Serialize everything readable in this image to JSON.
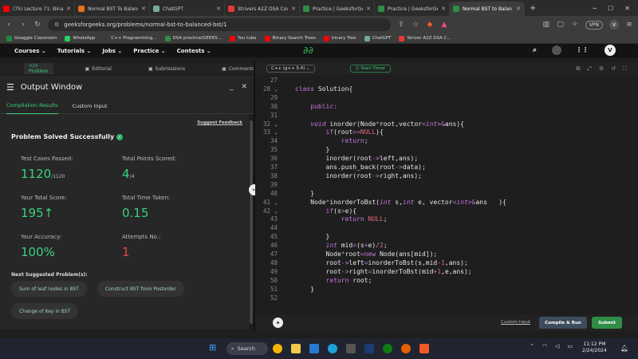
{
  "browser": {
    "tabs": [
      {
        "title": "(75) Lecture 71: Binary Se",
        "color": "#ff0000"
      },
      {
        "title": "Normal BST To Balanced",
        "color": "#e8711c"
      },
      {
        "title": "ChatGPT",
        "color": "#74aa9c"
      },
      {
        "title": "Strivers A2Z DSA Course",
        "color": "#e53935"
      },
      {
        "title": "Practice | GeeksforGeeks",
        "color": "#2f8d46"
      },
      {
        "title": "Practice | GeeksforGeeks",
        "color": "#2f8d46"
      },
      {
        "title": "Normal BST to Balan",
        "color": "#2f8d46"
      }
    ],
    "url": "geeksforgeeks.org/problems/normal-bst-to-balanced-bst/1",
    "vpn_label": "VPN",
    "profile_initial": "V"
  },
  "bookmarks": [
    {
      "label": "Googgle Classroom",
      "color": "#1e8e3e"
    },
    {
      "label": "WhatsApp",
      "color": "#25d366"
    },
    {
      "label": "C++ Programming...",
      "color": "#3a3a3a"
    },
    {
      "label": "DSA practice(GEEKS...",
      "color": "#2f8d46"
    },
    {
      "label": "You tube",
      "color": "#ff0000"
    },
    {
      "label": "Binary Search Trees",
      "color": "#ff0000"
    },
    {
      "label": "binary Tree",
      "color": "#ff0000"
    },
    {
      "label": "ChatGPT",
      "color": "#74aa9c"
    },
    {
      "label": "Striver A2Z DSA C...",
      "color": "#e53935"
    }
  ],
  "site_nav": [
    "Courses ⌄",
    "Tutorials ⌄",
    "Jobs ⌄",
    "Practice ⌄",
    "Contests ⌄"
  ],
  "problem_tabs": [
    "</> Problem",
    "Editorial",
    "Submissions",
    "Comments"
  ],
  "output": {
    "window_title": "Output Window",
    "subtabs": [
      "Compilation Results",
      "Custom Input"
    ],
    "suggest_feedback": "Suggest Feedback",
    "status": "Problem Solved Successfully",
    "test_cases_label": "Test Cases Passed:",
    "test_cases_value": "1120",
    "test_cases_total": "/1120",
    "points_label": "Total Points Scored:",
    "points_value": "4",
    "points_total": "/4",
    "score_label": "Your Total Score:",
    "score_value": "195↑",
    "time_label": "Total Time Taken:",
    "time_value": "0.15",
    "accuracy_label": "Your Accuracy:",
    "accuracy_value": "100%",
    "attempts_label": "Attempts No.:",
    "attempts_value": "1",
    "next_label": "Next Suggested Problem(s):",
    "suggestions": [
      "Sum of leaf nodes in BST",
      "Construct BST from Postorder",
      "Change of Key in BST"
    ]
  },
  "editor": {
    "language": "C++ (g++ 5.4) ⌄",
    "timer": "Start Timer",
    "lines": [
      {
        "n": "27",
        "html": ""
      },
      {
        "n": "28 ⌄",
        "html": "<span class=\"kw\">class</span> Solution{"
      },
      {
        "n": "29",
        "html": ""
      },
      {
        "n": "30",
        "html": "    <span class=\"kw\">public:</span>"
      },
      {
        "n": "31",
        "html": ""
      },
      {
        "n": "32 ⌄",
        "html": "    <span class=\"ty\">void</span> inorder(Node<span class=\"op\">*</span>root,vector<span class=\"op\">&lt;</span><span class=\"ty\">int</span><span class=\"op\">&gt;</span><span class=\"op\">&amp;</span>ans){"
      },
      {
        "n": "33 ⌄",
        "html": "        <span class=\"kw\">if</span>(root<span class=\"op\">==</span><span class=\"nm\">NULL</span>){"
      },
      {
        "n": "34",
        "html": "            <span class=\"kw\">return</span>;"
      },
      {
        "n": "35",
        "html": "        }"
      },
      {
        "n": "36",
        "html": "        inorder(root<span class=\"op\">-&gt;</span>left,ans);"
      },
      {
        "n": "37",
        "html": "        ans.push_back(root<span class=\"op\">-&gt;</span>data);"
      },
      {
        "n": "38",
        "html": "        inorder(root<span class=\"op\">-&gt;</span>right,ans);"
      },
      {
        "n": "39",
        "html": ""
      },
      {
        "n": "40",
        "html": "    }"
      },
      {
        "n": "41 ⌄",
        "html": "    Node<span class=\"op\">*</span>inorderToBst(<span class=\"ty\">int</span> s,<span class=\"ty\">int</span> e, vector<span class=\"op\">&lt;</span><span class=\"ty\">int</span><span class=\"op\">&gt;</span><span class=\"op\">&amp;</span>ans   ){"
      },
      {
        "n": "42 ⌄",
        "html": "        <span class=\"kw\">if</span>(s<span class=\"op\">&gt;</span>e){"
      },
      {
        "n": "43",
        "html": "            <span class=\"kw\">return</span> <span class=\"nm\">NULL</span>;"
      },
      {
        "n": "44",
        "html": ""
      },
      {
        "n": "45",
        "html": "        }"
      },
      {
        "n": "46",
        "html": "        <span class=\"ty\">int</span> mid<span class=\"op\">=</span>(s<span class=\"op\">+</span>e)<span class=\"op\">/</span><span class=\"nm\">2</span>;"
      },
      {
        "n": "47",
        "html": "        Node<span class=\"op\">*</span>root<span class=\"op\">=</span><span class=\"kw\">new</span> Node(ans[mid]);"
      },
      {
        "n": "48",
        "html": "        root<span class=\"op\">-&gt;</span>left<span class=\"op\">=</span>inorderToBst(s,mid<span class=\"op\">-</span><span class=\"nm\">1</span>,ans);"
      },
      {
        "n": "49",
        "html": "        root<span class=\"op\">-&gt;</span>right<span class=\"op\">=</span>inorderToBst(mid<span class=\"op\">+</span><span class=\"nm\">1</span>,e,ans);"
      },
      {
        "n": "50",
        "html": "        <span class=\"kw\">return</span> root;"
      },
      {
        "n": "51",
        "html": "    }"
      },
      {
        "n": "52",
        "html": ""
      }
    ],
    "custom_input": "Custom Input",
    "compile_label": "Compile & Run",
    "submit_label": "Submit",
    "compile_color": "#3e4d5e",
    "submit_color": "#2f8d46"
  },
  "taskbar": {
    "search_label": "Search",
    "time": "11:12 PM",
    "date": "2/24/2024"
  }
}
